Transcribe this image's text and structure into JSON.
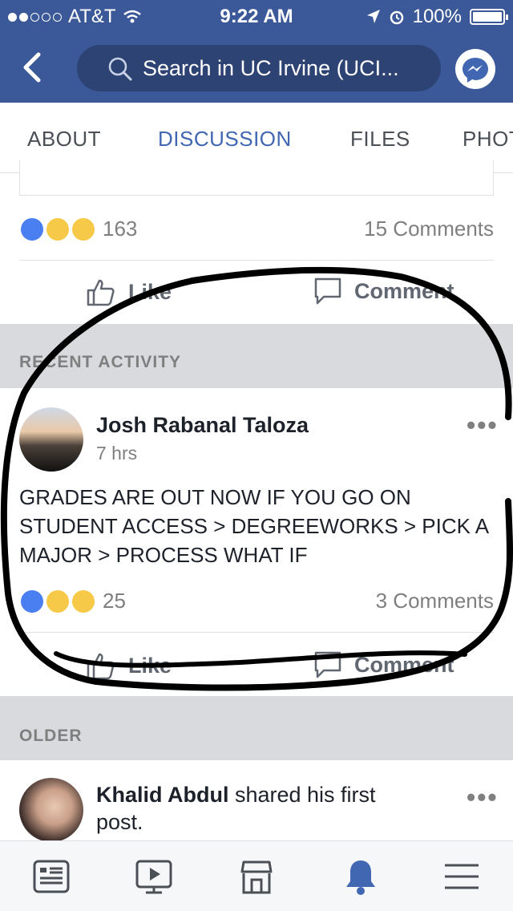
{
  "status_bar": {
    "carrier": "AT&T",
    "time": "9:22 AM",
    "battery": "100%"
  },
  "nav": {
    "search_placeholder": "Search in UC Irvine (UCI..."
  },
  "tabs": [
    {
      "label": "ABOUT",
      "active": false
    },
    {
      "label": "DISCUSSION",
      "active": true
    },
    {
      "label": "FILES",
      "active": false
    },
    {
      "label": "PHOTOS",
      "active": false
    }
  ],
  "prev_post": {
    "reaction_count": "163",
    "comments": "15 Comments",
    "like_label": "Like",
    "comment_label": "Comment"
  },
  "recent_activity": {
    "header": "RECENT ACTIVITY",
    "post": {
      "author": "Josh Rabanal Taloza",
      "time": "7 hrs",
      "text": "GRADES ARE OUT NOW IF YOU GO ON STUDENT ACCESS > DEGREEWORKS >  PICK A MAJOR > PROCESS WHAT IF",
      "reaction_count": "25",
      "comments": "3 Comments",
      "like_label": "Like",
      "comment_label": "Comment"
    }
  },
  "older": {
    "header": "OLDER",
    "post": {
      "author": "Khalid Abdul",
      "action_text": " shared his first post."
    }
  },
  "colors": {
    "brand": "#3b5998",
    "accent": "#4267b2",
    "annotation": "#000000"
  },
  "bottom_nav": [
    "news-feed-icon",
    "video-icon",
    "marketplace-icon",
    "notifications-icon",
    "menu-icon"
  ]
}
